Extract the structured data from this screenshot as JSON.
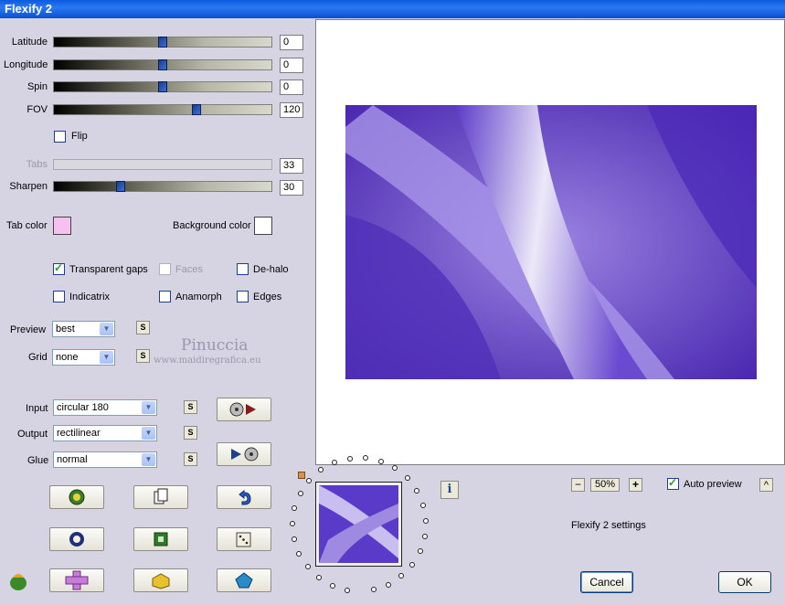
{
  "window": {
    "title": "Flexify 2"
  },
  "sliders": [
    {
      "label": "Latitude",
      "value": "0",
      "fraction": 0.5
    },
    {
      "label": "Longitude",
      "value": "0",
      "fraction": 0.5
    },
    {
      "label": "Spin",
      "value": "0",
      "fraction": 0.5
    },
    {
      "label": "FOV",
      "value": "120",
      "fraction": 0.67
    },
    {
      "label": "Tabs",
      "value": "33",
      "disabled": true
    },
    {
      "label": "Sharpen",
      "value": "30",
      "fraction": 0.3
    }
  ],
  "flip": {
    "label": "Flip",
    "checked": false
  },
  "colors": {
    "tab_label": "Tab color",
    "tab_value": "#f8c0f0",
    "background_label": "Background color",
    "background_value": "#ffffff"
  },
  "options": {
    "transparent_gaps": "Transparent gaps",
    "faces": "Faces",
    "de_halo": "De-halo",
    "indicatrix": "Indicatrix",
    "anamorph": "Anamorph",
    "edges": "Edges"
  },
  "preview_select": {
    "label": "Preview",
    "value": "best"
  },
  "grid_select": {
    "label": "Grid",
    "value": "none"
  },
  "input_select": {
    "label": "Input",
    "value": "circular 180"
  },
  "output_select": {
    "label": "Output",
    "value": "rectilinear"
  },
  "glue_select": {
    "label": "Glue",
    "value": "normal"
  },
  "small_button_label": "S",
  "watermark": {
    "line1": "Pinuccia",
    "line2": "www.maidiregrafica.eu"
  },
  "zoom": {
    "minus": "−",
    "value": "50%",
    "plus": "+"
  },
  "auto_preview": {
    "label": "Auto preview",
    "checked": true
  },
  "collapse_glyph": "^",
  "info_glyph": "i",
  "settings_text": "Flexify 2 settings",
  "buttons": {
    "cancel": "Cancel",
    "ok": "OK"
  },
  "accent": {
    "purple": "#4a2fb0",
    "title_blue": "#0a5be0"
  }
}
